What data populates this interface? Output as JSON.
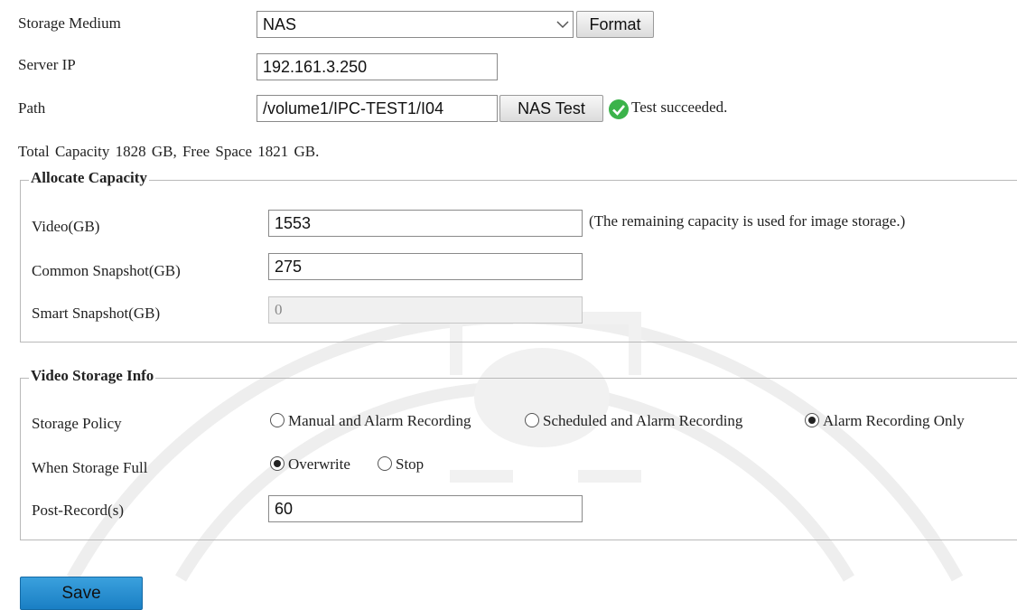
{
  "storage": {
    "medium_label": "Storage Medium",
    "medium_value": "NAS",
    "format_label": "Format",
    "server_ip_label": "Server IP",
    "server_ip_value": "192.161.3.250",
    "path_label": "Path",
    "path_value": "/volume1/IPC-TEST1/I04",
    "nas_test_label": "NAS Test",
    "test_result": "Test succeeded.",
    "capacity_summary": "Total Capacity  1828  GB,  Free Space  1821  GB."
  },
  "allocate": {
    "legend": "Allocate Capacity",
    "video_label": "Video(GB)",
    "video_value": "1553",
    "video_note": "(The remaining capacity is used for image storage.)",
    "common_label": "Common Snapshot(GB)",
    "common_value": "275",
    "smart_label": "Smart Snapshot(GB)",
    "smart_value": "0"
  },
  "video_info": {
    "legend": "Video Storage Info",
    "policy_label": "Storage Policy",
    "policy_options": [
      "Manual and Alarm Recording",
      "Scheduled and Alarm Recording",
      "Alarm Recording Only"
    ],
    "policy_selected": "Alarm Recording Only",
    "full_label": "When Storage Full",
    "full_options": [
      "Overwrite",
      "Stop"
    ],
    "full_selected": "Overwrite",
    "post_record_label": "Post-Record(s)",
    "post_record_value": "60"
  },
  "actions": {
    "save_label": "Save"
  },
  "colors": {
    "save_button": "#1a7fc4",
    "success_icon": "#3bb34a"
  }
}
